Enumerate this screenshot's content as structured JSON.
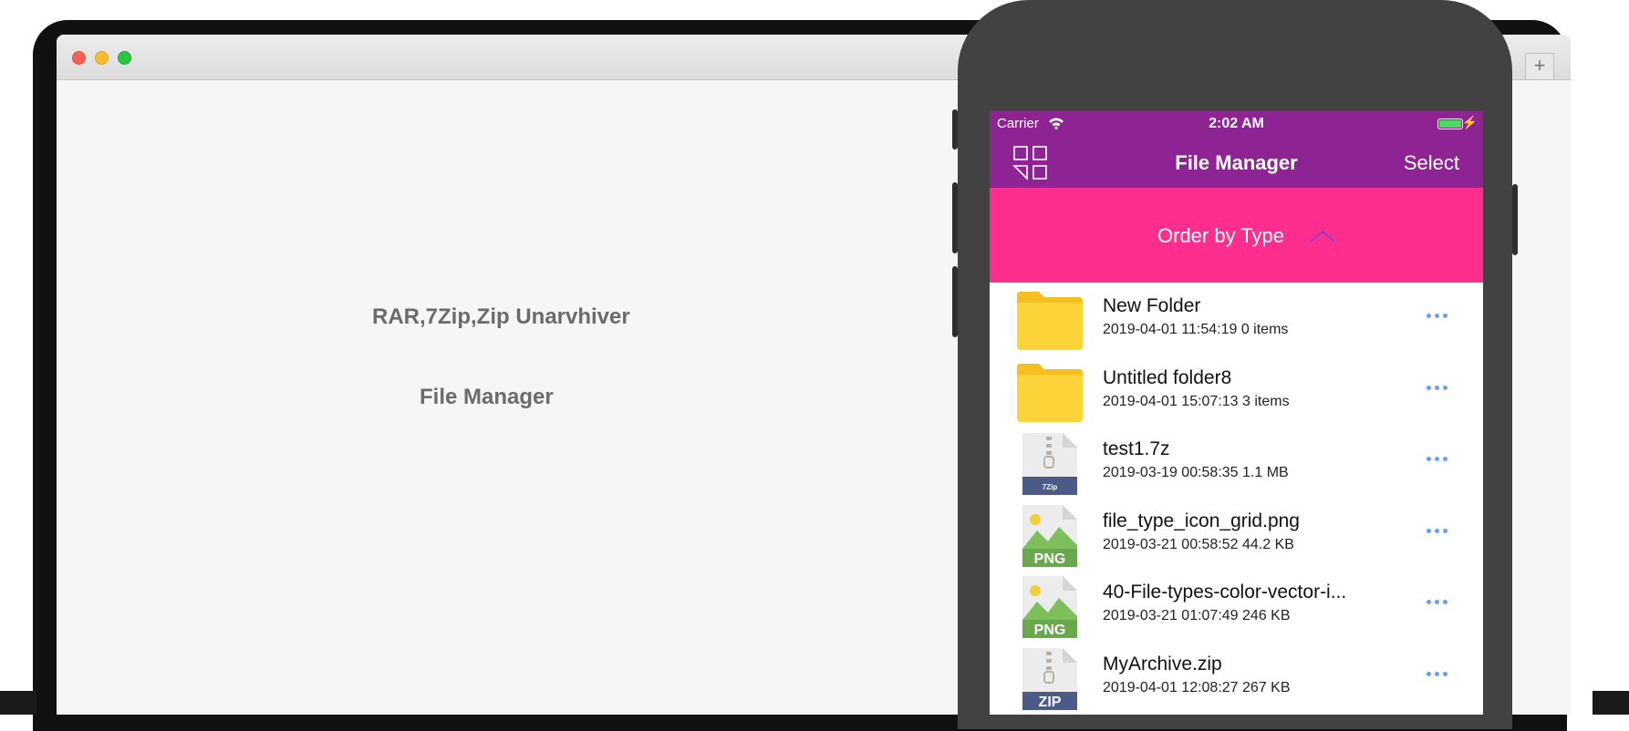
{
  "window": {
    "newtab_label": "+"
  },
  "desktop": {
    "title_line1": "RAR,7Zip,Zip Unarvhiver",
    "title_line2": "File Manager"
  },
  "phone": {
    "status": {
      "carrier": "Carrier",
      "time": "2:02 AM",
      "battery_level": 1.0
    },
    "navbar": {
      "title": "File Manager",
      "select_label": "Select"
    },
    "order": {
      "label": "Order by Type"
    },
    "files": [
      {
        "name": "New Folder",
        "meta": "2019-04-01 11:54:19 0 items",
        "icon": "folder-icon"
      },
      {
        "name": "Untitled folder8",
        "meta": "2019-04-01 15:07:13 3 items",
        "icon": "folder-icon"
      },
      {
        "name": "test1.7z",
        "meta": "2019-03-19 00:58:35 1.1 MB",
        "icon": "7zip-file-icon",
        "badge": "7Zip"
      },
      {
        "name": "file_type_icon_grid.png",
        "meta": "2019-03-21 00:58:52 44.2 KB",
        "icon": "png-file-icon",
        "badge": "PNG"
      },
      {
        "name": "40-File-types-color-vector-i...",
        "meta": "2019-03-21 01:07:49 246 KB",
        "icon": "png-file-icon",
        "badge": "PNG"
      },
      {
        "name": "MyArchive.zip",
        "meta": "2019-04-01 12:08:27 267 KB",
        "icon": "zip-file-icon",
        "badge": "ZIP"
      }
    ]
  },
  "colors": {
    "navbar_purple": "#8e2493",
    "order_pink": "#fe2e8e",
    "folder_yellow": "#fdd33a",
    "png_green": "#6aa84f",
    "archive_navy": "#4b5a86",
    "more_blue": "#6d9cf0"
  }
}
